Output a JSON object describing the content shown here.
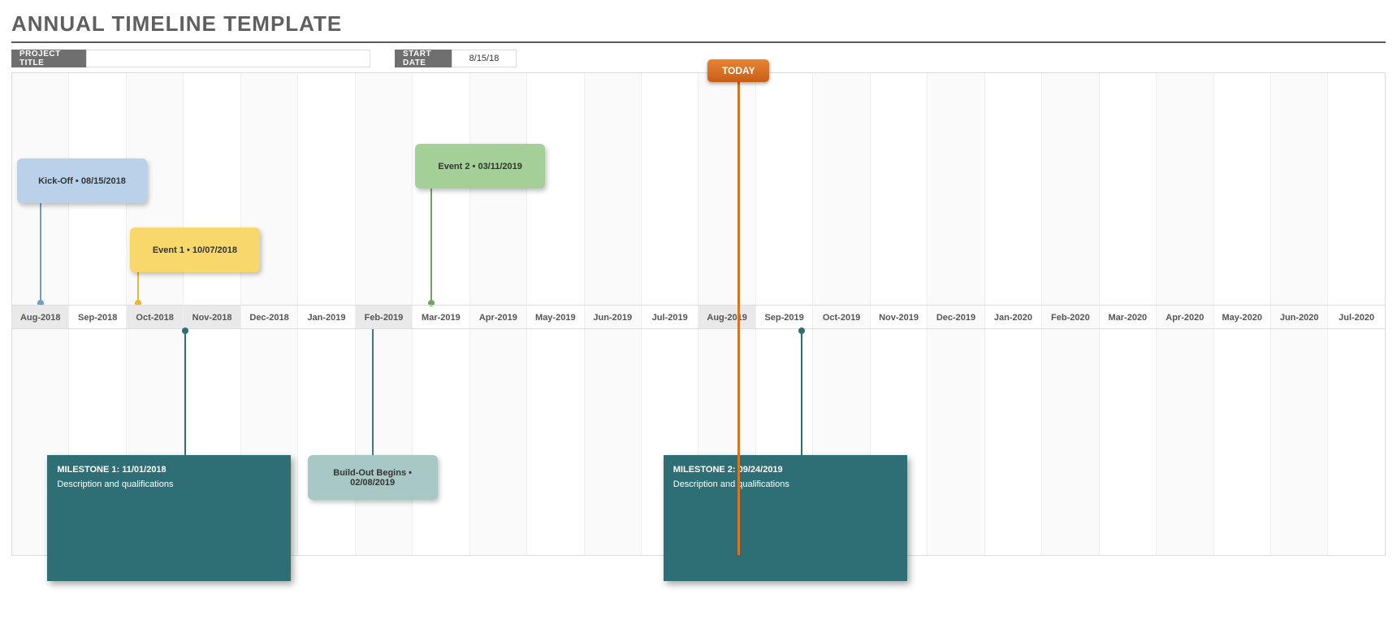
{
  "title": "ANNUAL TIMELINE TEMPLATE",
  "header": {
    "project_title_label": "PROJECT TITLE",
    "project_title_value": "",
    "start_date_label": "START DATE",
    "start_date_value": "8/15/18"
  },
  "today_label": "TODAY",
  "chart_data": {
    "type": "timeline",
    "months": [
      "Aug-2018",
      "Sep-2018",
      "Oct-2018",
      "Nov-2018",
      "Dec-2018",
      "Jan-2019",
      "Feb-2019",
      "Mar-2019",
      "Apr-2019",
      "May-2019",
      "Jun-2019",
      "Jul-2019",
      "Aug-2019",
      "Sep-2019",
      "Oct-2019",
      "Nov-2019",
      "Dec-2019",
      "Jan-2020",
      "Feb-2020",
      "Mar-2020",
      "Apr-2020",
      "May-2020",
      "Jun-2020",
      "Jul-2020"
    ],
    "month_shaded": [
      true,
      false,
      true,
      true,
      false,
      false,
      true,
      false,
      false,
      false,
      false,
      false,
      true,
      false,
      false,
      false,
      false,
      false,
      false,
      false,
      false,
      false,
      false,
      false
    ],
    "today_position_month_index": 12.7,
    "events_above": [
      {
        "label": "Kick-Off • 08/15/2018",
        "month_index": 0.5,
        "card_color": "#b9d2ea",
        "stem_color": "#6f9fc9",
        "row": 0
      },
      {
        "label": "Event 1 • 10/07/2018",
        "month_index": 2.2,
        "card_color": "#f8d76b",
        "stem_color": "#e3b93a",
        "row": 1
      },
      {
        "label": "Event 2 • 03/11/2019",
        "month_index": 7.33,
        "card_color": "#a4cf97",
        "stem_color": "#6ea661",
        "row": 2
      }
    ],
    "events_below": [
      {
        "label": "Build-Out Begins • 02/08/2019",
        "month_index": 6.3,
        "card_color": "#a8c8c6",
        "stem_color": "#3d7a80"
      }
    ],
    "milestones": [
      {
        "title": "MILESTONE 1: 11/01/2018",
        "desc": "Description and qualifications",
        "month_index": 3.03,
        "stem_color": "#2e6e75"
      },
      {
        "title": "MILESTONE 2: 09/24/2019",
        "desc": "Description and qualifications",
        "month_index": 13.8,
        "stem_color": "#2e6e75"
      }
    ]
  }
}
